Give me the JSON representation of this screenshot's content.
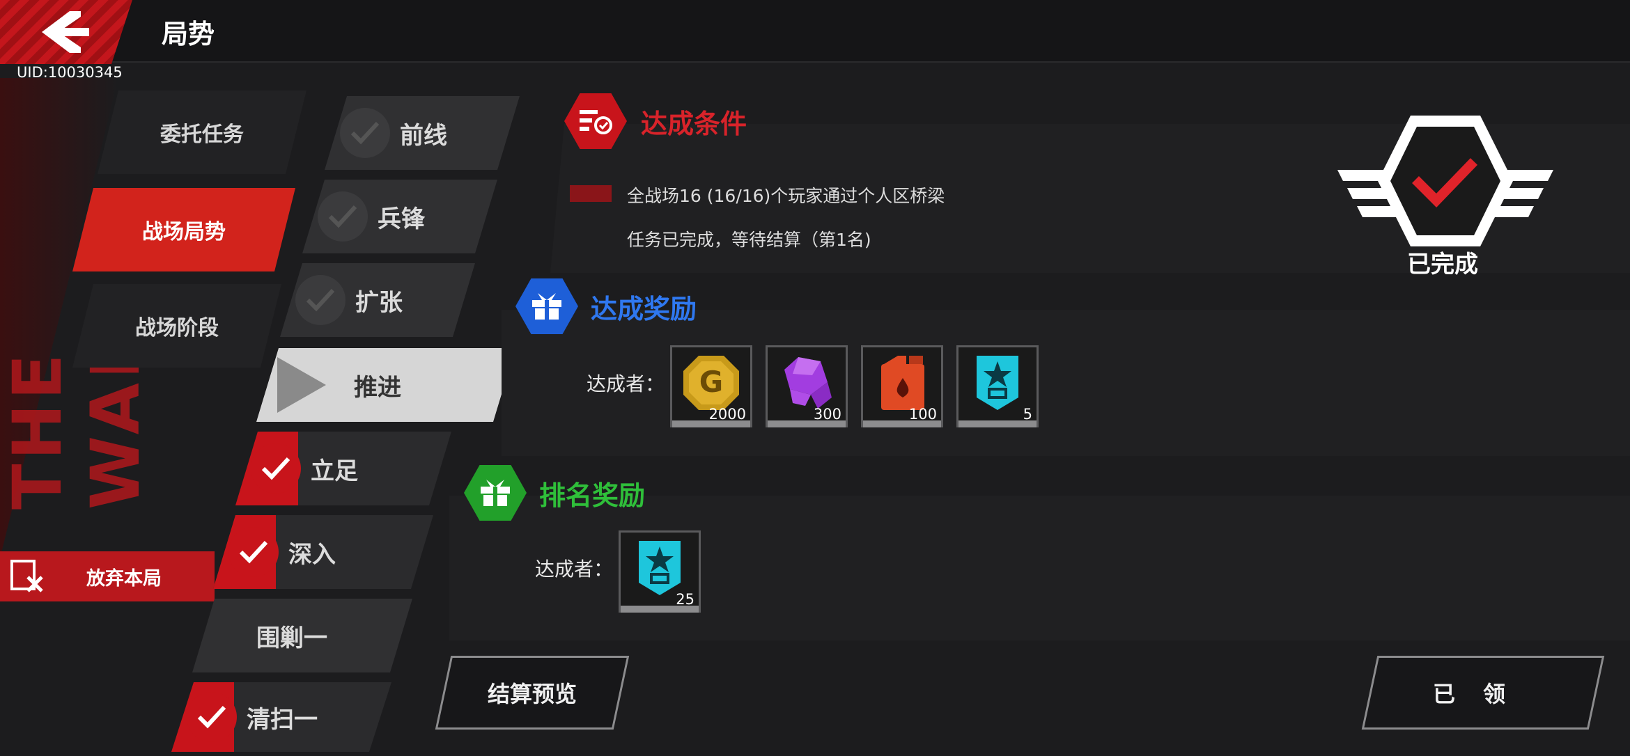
{
  "header": {
    "title": "局势",
    "uid": "UID:10030345"
  },
  "decor": {
    "war_text": "THE WAR"
  },
  "menu": [
    {
      "label": "委托任务",
      "active": false
    },
    {
      "label": "战场局势",
      "active": true
    },
    {
      "label": "战场阶段",
      "active": false
    }
  ],
  "abandon": {
    "label": "放弃本局"
  },
  "stages": [
    {
      "label": "前线",
      "state": "locked"
    },
    {
      "label": "兵锋",
      "state": "locked"
    },
    {
      "label": "扩张",
      "state": "locked"
    },
    {
      "label": "推进",
      "state": "current"
    },
    {
      "label": "立足",
      "state": "done"
    },
    {
      "label": "深入",
      "state": "done"
    },
    {
      "label": "围剿一",
      "state": "none"
    },
    {
      "label": "清扫一",
      "state": "done"
    }
  ],
  "condition": {
    "title": "达成条件",
    "text": "全战场16 (16/16)个玩家通过个人区桥梁",
    "status": "任务已完成，等待结算（第1名)",
    "badge_color": "#c8141b"
  },
  "reward": {
    "title": "达成奖励",
    "achiever_label": "达成者：",
    "badge_color": "#1e5fd8",
    "items": [
      {
        "icon": "gold-coin-icon",
        "qty": "2000"
      },
      {
        "icon": "purple-crystal-icon",
        "qty": "300"
      },
      {
        "icon": "fuel-can-icon",
        "qty": "100"
      },
      {
        "icon": "star-badge-icon",
        "qty": "5"
      }
    ]
  },
  "ranking": {
    "title": "排名奖励",
    "achiever_label": "达成者：",
    "badge_color": "#22a02a",
    "items": [
      {
        "icon": "star-badge-icon",
        "qty": "25"
      }
    ]
  },
  "status": {
    "label": "已完成"
  },
  "buttons": {
    "preview": "结算预览",
    "claimed": "已领"
  }
}
